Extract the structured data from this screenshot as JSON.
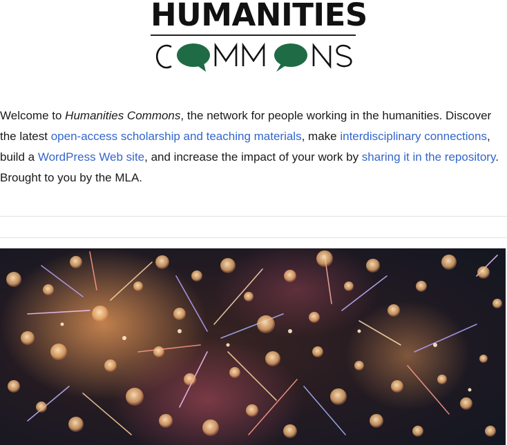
{
  "logo": {
    "line1": "HUMANITIES",
    "line2": "COMMONS",
    "colors": {
      "text": "#111111",
      "bubble": "#1f6b45"
    }
  },
  "intro": {
    "t1": "Welcome to ",
    "site_name": "Humanities Commons",
    "t2": ", the network for people working in the humanities. Discover the latest ",
    "link_scholarship": "open-access scholarship and teaching materials",
    "t3": ", make ",
    "link_connections": "interdisciplinary connections",
    "t4": ", build a ",
    "link_wordpress": "WordPress Web site",
    "t5": ", and increase the impact of your work by ",
    "link_repository": "sharing it in the repository",
    "t6": ". Brought to you by the MLA."
  },
  "theme": {
    "link_color": "#3366cc",
    "text_color": "#1a1a1a"
  }
}
